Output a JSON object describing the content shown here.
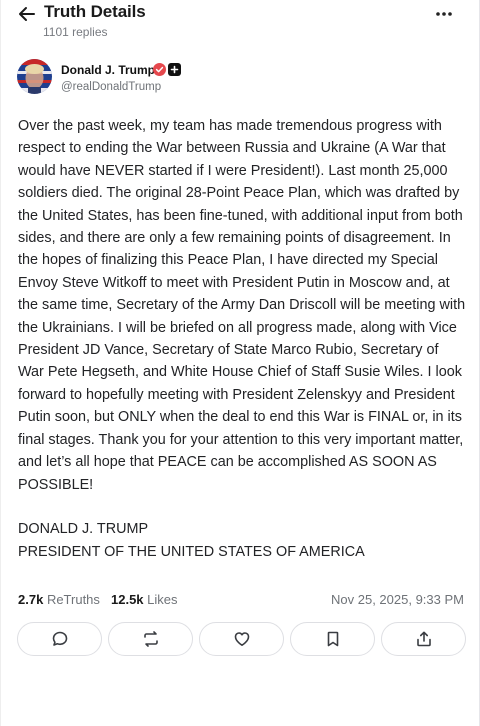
{
  "header": {
    "title": "Truth Details",
    "replies": "1101 replies"
  },
  "author": {
    "name": "Donald J. Trump",
    "handle": "@realDonaldTrump"
  },
  "post": {
    "body": "Over the past week, my team has made tremendous progress with respect to ending the War between Russia and Ukraine (A War that would have NEVER started if I were President!). Last month 25,000 soldiers died. The original 28-Point Peace Plan, which was drafted by the United States, has been fine-tuned, with additional input from both sides, and there are only a few remaining points of disagreement. In the hopes of finalizing this Peace Plan, I have directed my Special Envoy Steve Witkoff to meet with President Putin in Moscow and, at the same time, Secretary of the Army Dan Driscoll will be meeting with the Ukrainians. I will be briefed on all progress made, along with Vice President JD Vance, Secretary of State Marco Rubio, Secretary of War Pete Hegseth, and White House Chief of Staff Susie Wiles. I look forward to hopefully meeting with President Zelenskyy and President Putin soon, but ONLY when the deal to end this War is FINAL or, in its final stages. Thank you for your attention to this very important matter, and let’s all hope that PEACE can be accomplished AS SOON AS POSSIBLE!",
    "signature_line1": "DONALD J. TRUMP",
    "signature_line2": "PRESIDENT OF THE UNITED STATES OF AMERICA"
  },
  "stats": {
    "retruths_count": "2.7k",
    "retruths_label": "ReTruths",
    "likes_count": "12.5k",
    "likes_label": "Likes",
    "timestamp": "Nov 25, 2025, 9:33 PM"
  },
  "actions": [
    {
      "icon": "reply-icon"
    },
    {
      "icon": "retruth-icon"
    },
    {
      "icon": "heart-icon"
    },
    {
      "icon": "bookmark-icon"
    },
    {
      "icon": "share-icon"
    }
  ],
  "colors": {
    "verified_badge": "#e5484d",
    "muted_text": "#6f7378",
    "icon_stroke": "#3a3d42"
  }
}
